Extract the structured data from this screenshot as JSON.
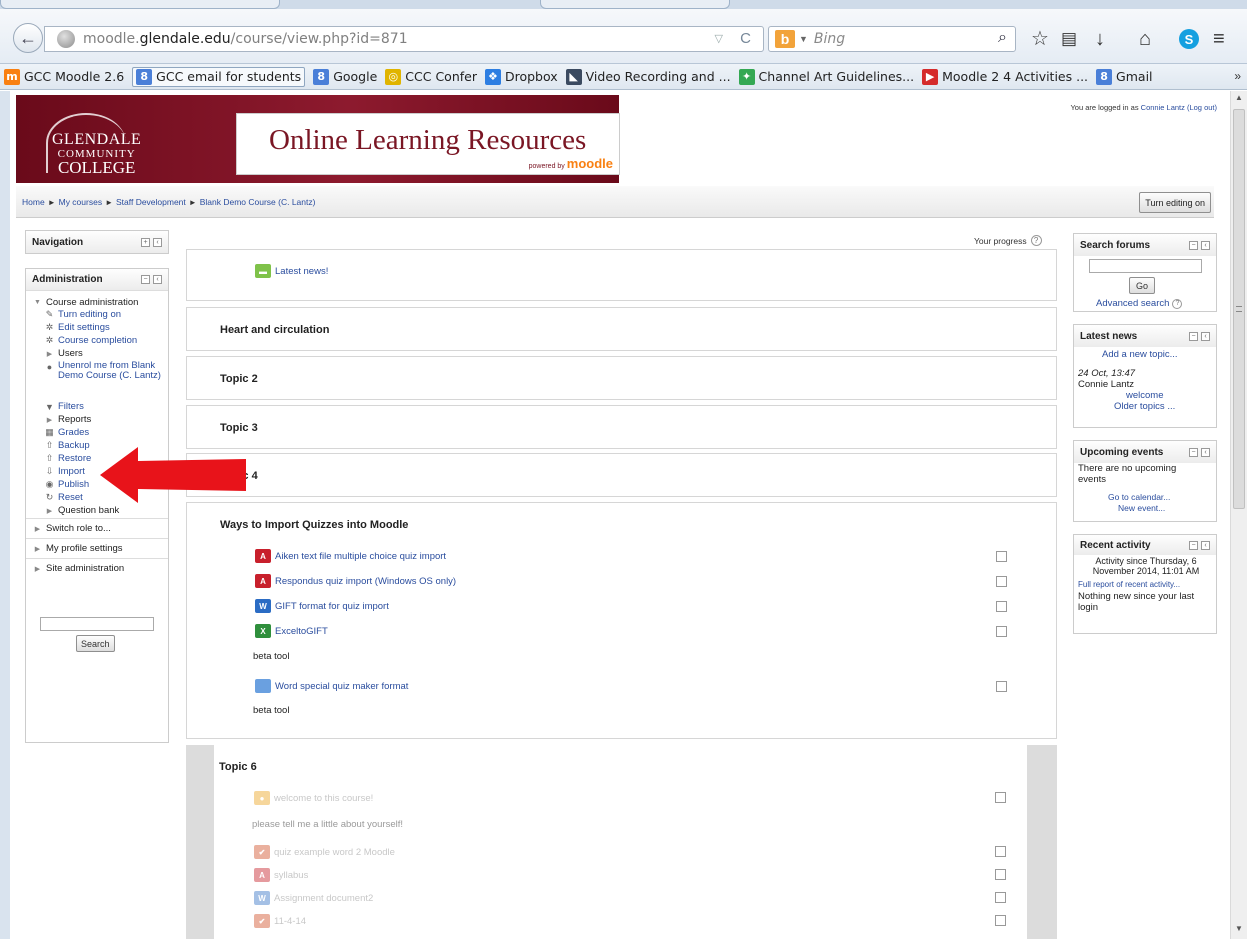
{
  "browser": {
    "url_prefix": "moodle.",
    "url_domain": "glendale.edu",
    "url_path": "/course/view.php?id=871",
    "search_engine_logo": "b",
    "search_placeholder": "Bing",
    "icons": [
      "back-arrow-icon",
      "globe-icon",
      "reload-icon",
      "search-icon",
      "star-icon",
      "reading-list-icon",
      "download-icon",
      "home-icon",
      "skype-icon",
      "menu-icon"
    ]
  },
  "bookmarks": [
    {
      "label": "GCC Moodle 2.6",
      "icon": "moodle-icon",
      "color": "#f98012",
      "glyph": "m"
    },
    {
      "label": "GCC email for students",
      "icon": "google-icon",
      "color": "#4a7fd8",
      "glyph": "8",
      "active": true
    },
    {
      "label": "Google",
      "icon": "google-icon",
      "color": "#4a7fd8",
      "glyph": "8"
    },
    {
      "label": "CCC Confer",
      "icon": "confer-icon",
      "color": "#e0b400",
      "glyph": "◎"
    },
    {
      "label": "Dropbox",
      "icon": "dropbox-icon",
      "color": "#2d7ee2",
      "glyph": "❖"
    },
    {
      "label": "Video Recording and ...",
      "icon": "video-icon",
      "color": "#3b4a60",
      "glyph": "◣"
    },
    {
      "label": "Channel Art Guidelines...",
      "icon": "google-colors-icon",
      "color": "#34a853",
      "glyph": "✦"
    },
    {
      "label": "Moodle 2 4 Activities ...",
      "icon": "youtube-icon",
      "color": "#d52b2b",
      "glyph": "▶"
    },
    {
      "label": "Gmail",
      "icon": "google-icon",
      "color": "#4a7fd8",
      "glyph": "8"
    }
  ],
  "bookmarks_more": "»",
  "header": {
    "logo_line1": "GLENDALE",
    "logo_line2": "COMMUNITY",
    "logo_line3": "COLLEGE",
    "site_title": "Online Learning Resources",
    "powered_by": "powered by",
    "powered_brand": "moodle",
    "logged_in_prefix": "You are logged in as",
    "logged_in_user": "Connie Lantz",
    "logout_label": "(Log out)"
  },
  "breadcrumb": [
    "Home",
    "My courses",
    "Staff Development",
    "Blank Demo Course (C. Lantz)"
  ],
  "breadcrumb_sep": "►",
  "turn_editing_button": "Turn editing on",
  "left_blocks": {
    "navigation_title": "Navigation",
    "administration_title": "Administration",
    "tree": [
      {
        "label": "Course administration",
        "icon": "triangle-down-icon",
        "link": false
      },
      {
        "label": "Turn editing on",
        "icon": "pencil-icon",
        "link": true
      },
      {
        "label": "Edit settings",
        "icon": "gear-icon",
        "link": true
      },
      {
        "label": "Course completion",
        "icon": "gear-icon",
        "link": true
      },
      {
        "label": "Users",
        "icon": "triangle-right-icon",
        "link": false
      },
      {
        "label": "Unenrol me from Blank Demo Course (C. Lantz)",
        "icon": "user-icon",
        "link": true
      },
      {
        "label": "Filters",
        "icon": "filter-icon",
        "link": true
      },
      {
        "label": "Reports",
        "icon": "triangle-right-icon",
        "link": false
      },
      {
        "label": "Grades",
        "icon": "grades-icon",
        "link": true
      },
      {
        "label": "Backup",
        "icon": "backup-icon",
        "link": true
      },
      {
        "label": "Restore",
        "icon": "restore-icon",
        "link": true
      },
      {
        "label": "Import",
        "icon": "import-icon",
        "link": true
      },
      {
        "label": "Publish",
        "icon": "publish-icon",
        "link": true
      },
      {
        "label": "Reset",
        "icon": "reset-icon",
        "link": true
      },
      {
        "label": "Question bank",
        "icon": "triangle-right-icon",
        "link": false
      },
      {
        "label": "Switch role to...",
        "icon": "triangle-right-icon",
        "link": false
      },
      {
        "label": "My profile settings",
        "icon": "triangle-right-icon",
        "link": false
      },
      {
        "label": "Site administration",
        "icon": "triangle-right-icon",
        "link": false
      }
    ],
    "search_button": "Search"
  },
  "center": {
    "your_progress": "Your progress",
    "latest_news": "Latest news!",
    "sections": [
      "Heart and circulation",
      "Topic 2",
      "Topic 3",
      "Topic 4",
      "Ways to Import Quizzes into Moodle",
      "Topic 6"
    ],
    "import_items": [
      {
        "label": "Aiken text file multiple choice quiz import",
        "icon": "pdf-icon",
        "color": "#c8202c",
        "glyph": "A"
      },
      {
        "label": "Respondus quiz import (Windows OS only)",
        "icon": "pdf-icon",
        "color": "#c8202c",
        "glyph": "A"
      },
      {
        "label": "GIFT format for quiz import",
        "icon": "word-doc-icon",
        "color": "#2b6cc4",
        "glyph": "W"
      },
      {
        "label": "ExceltoGIFT",
        "icon": "excel-icon",
        "color": "#2f8f3c",
        "glyph": "X"
      }
    ],
    "beta_tool_1": "beta tool",
    "folder_item": "Word special quiz maker format",
    "beta_tool_2": "beta tool",
    "topic6_items": [
      {
        "label": "welcome to this course!",
        "icon": "forum-icon",
        "color": "#f0b54a",
        "glyph": "●"
      },
      {
        "label": "quiz example word 2 Moodle",
        "icon": "quiz-icon",
        "color": "#d97050",
        "glyph": "✔"
      },
      {
        "label": "syllabus",
        "icon": "pdf-icon",
        "color": "#d04850",
        "glyph": "A"
      },
      {
        "label": "Assignment document2",
        "icon": "word-doc-icon",
        "color": "#5a8ed0",
        "glyph": "W"
      },
      {
        "label": "11-4-14",
        "icon": "quiz-icon",
        "color": "#d97050",
        "glyph": "✔"
      }
    ],
    "topic6_note": "please tell me a little about yourself!"
  },
  "right_blocks": {
    "search_forums_title": "Search forums",
    "go_button": "Go",
    "advanced_search": "Advanced search",
    "latest_news_title": "Latest news",
    "add_topic": "Add a new topic...",
    "news_date": "24 Oct, 13:47",
    "news_author": "Connie Lantz",
    "news_subject": "welcome",
    "older_topics": "Older topics ...",
    "upcoming_title": "Upcoming events",
    "no_events": "There are no upcoming events",
    "go_to_calendar": "Go to calendar...",
    "new_event": "New event...",
    "recent_title": "Recent activity",
    "activity_since": "Activity since Thursday, 6 November 2014, 11:01 AM",
    "full_report": "Full report of recent activity...",
    "nothing_new": "Nothing new since your last login"
  },
  "colors": {
    "arrow": "#e8131a",
    "link": "#2a4d9e",
    "banner": "#7a1624"
  }
}
